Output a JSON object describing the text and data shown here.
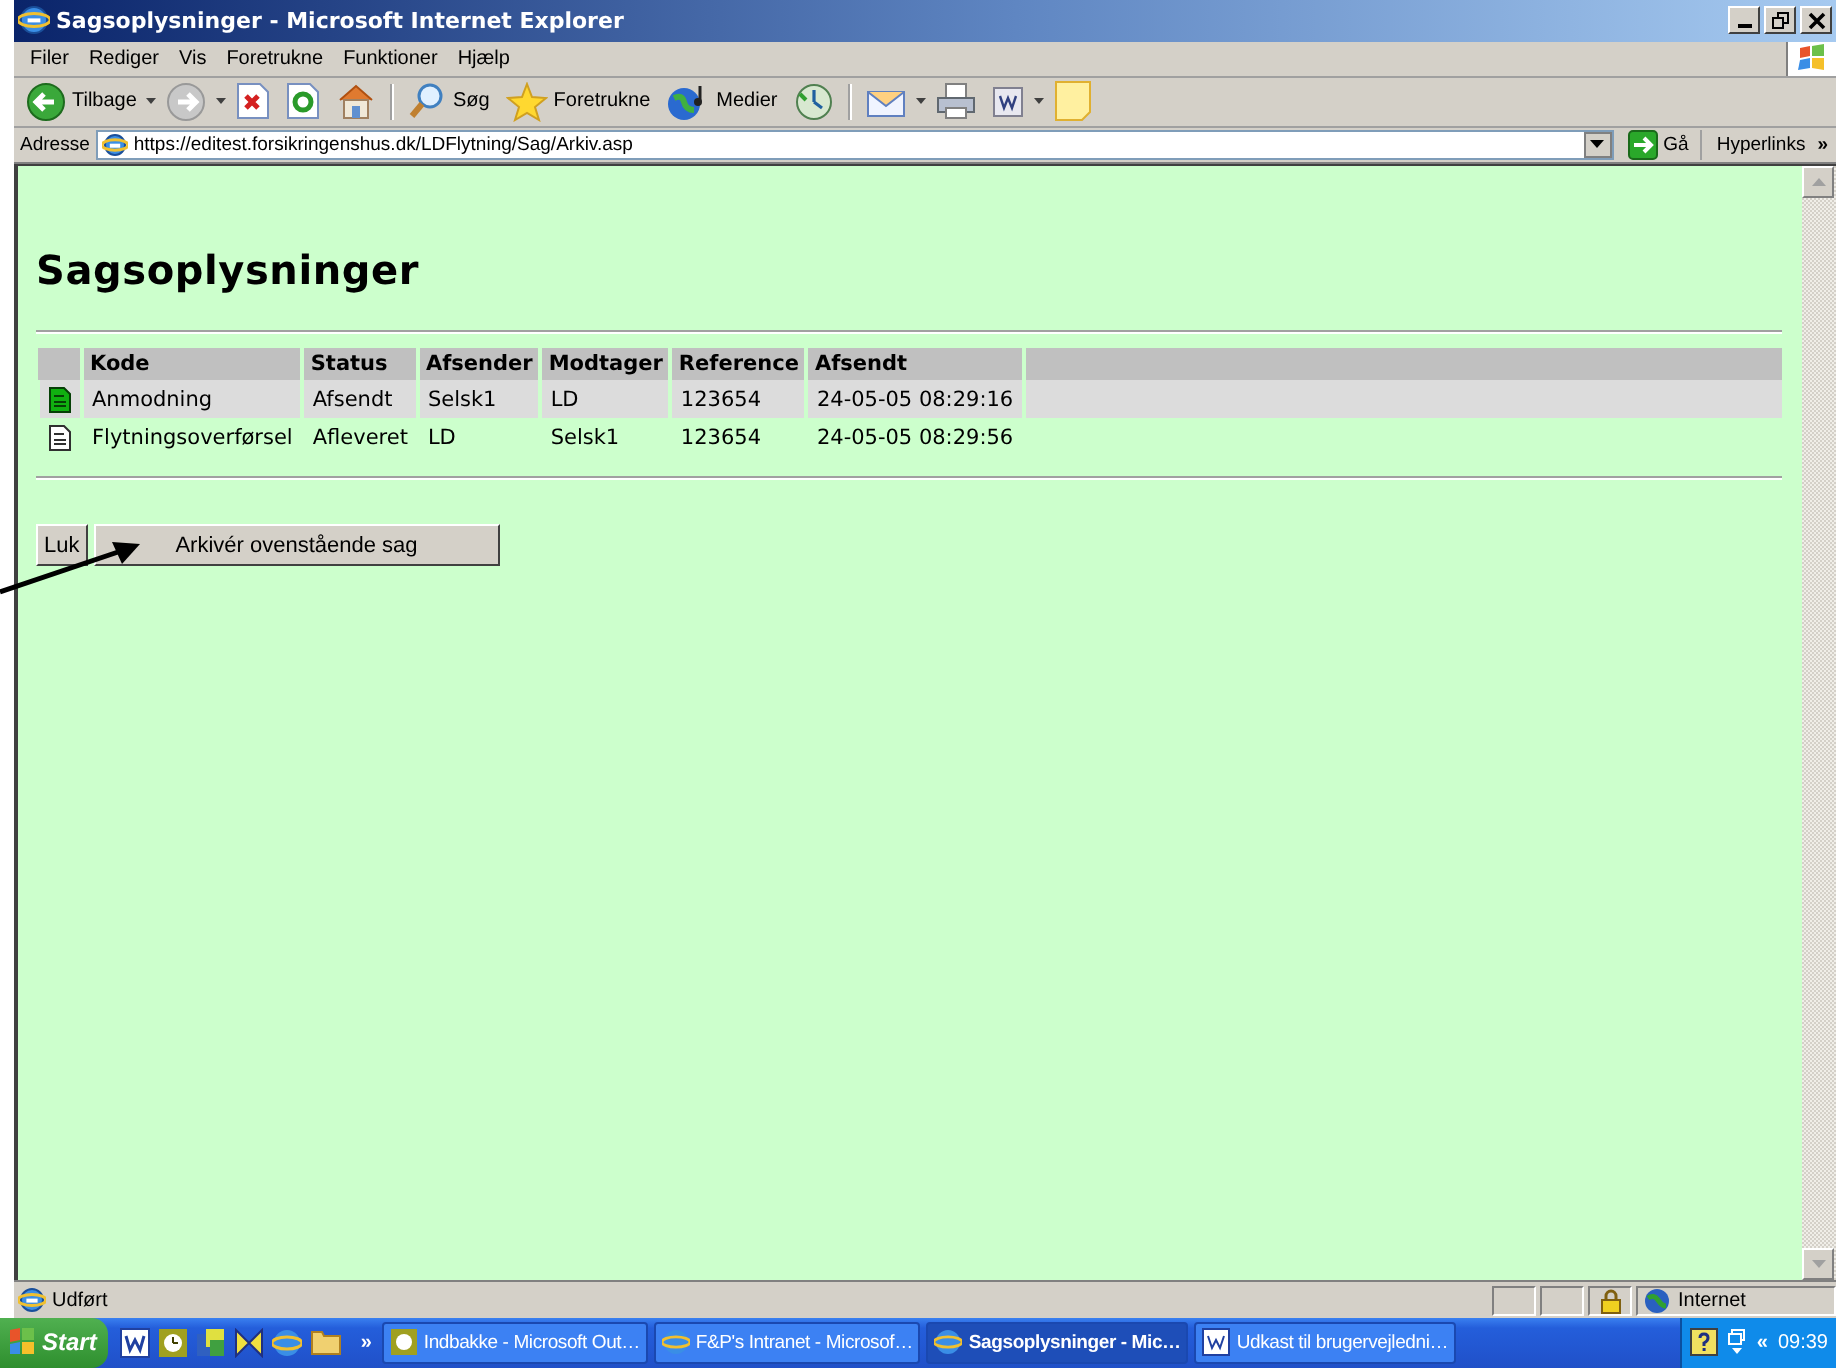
{
  "window": {
    "title": "Sagsoplysninger - Microsoft Internet Explorer"
  },
  "menu": [
    "Filer",
    "Rediger",
    "Vis",
    "Foretrukne",
    "Funktioner",
    "Hjælp"
  ],
  "toolbar": [
    {
      "kind": "back",
      "label": "Tilbage",
      "dropdown": true
    },
    {
      "kind": "forward",
      "dropdown": true
    },
    {
      "kind": "stop"
    },
    {
      "kind": "refresh"
    },
    {
      "kind": "home"
    },
    {
      "kind": "search",
      "label": "Søg"
    },
    {
      "kind": "favorites",
      "label": "Foretrukne"
    },
    {
      "kind": "media",
      "label": "Medier"
    },
    {
      "kind": "history"
    },
    {
      "kind": "mail",
      "dropdown": true
    },
    {
      "kind": "print"
    },
    {
      "kind": "edit",
      "dropdown": true
    },
    {
      "kind": "note"
    }
  ],
  "address": {
    "label": "Adresse",
    "value": "https://editest.forsikringenshus.dk/LDFlytning/Sag/Arkiv.asp",
    "go": "Gå",
    "links": "Hyperlinks",
    "more": "»"
  },
  "page": {
    "heading": "Sagsoplysninger",
    "columns": [
      "Kode",
      "Status",
      "Afsender",
      "Modtager",
      "Reference",
      "Afsendt"
    ],
    "rows": [
      {
        "kind": "filled",
        "selected": true,
        "cells": [
          "Anmodning",
          "Afsendt",
          "Selsk1",
          "LD",
          "123654",
          "24-05-05 08:29:16"
        ]
      },
      {
        "kind": "outline",
        "selected": false,
        "cells": [
          "Flytningsoverførsel",
          "Afleveret",
          "LD",
          "Selsk1",
          "123654",
          "24-05-05 08:29:56"
        ]
      }
    ],
    "buttons": [
      "Luk",
      "Arkivér ovenstående sag"
    ]
  },
  "status_bar": {
    "text": "Udført",
    "zone": "Internet"
  },
  "taskbar": {
    "start": "Start",
    "more": "»",
    "items": [
      {
        "kind": "outlook",
        "label": "Indbakke - Microsoft Out…",
        "selected": false
      },
      {
        "kind": "browser",
        "label": "F&P's Intranet - Microsof…",
        "selected": false
      },
      {
        "kind": "browser",
        "label": "Sagsoplysninger - Mic…",
        "selected": true
      },
      {
        "kind": "word",
        "label": "Udkast til brugervejledni…",
        "selected": false
      }
    ],
    "tray_toggle": "«",
    "clock": "09:39"
  }
}
